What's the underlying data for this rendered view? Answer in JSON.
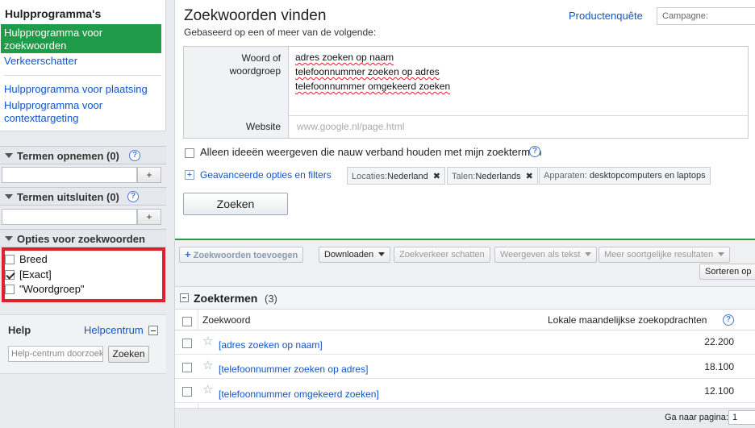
{
  "sidebar": {
    "tools_title": "Hulpprogramma's",
    "tools": [
      "Hulpprogramma voor zoekwoorden",
      "Verkeerschatter",
      "Hulpprogramma voor plaatsing",
      "Hulpprogramma voor contexttargeting"
    ],
    "include_terms_label": "Termen opnemen (0)",
    "exclude_terms_label": "Termen uitsluiten (0)",
    "add_button": "+",
    "match_options_label": "Opties voor zoekwoorden",
    "match_options": [
      {
        "label": "Breed",
        "checked": false
      },
      {
        "label": "[Exact]",
        "checked": true
      },
      {
        "label": "\"Woordgroep\"",
        "checked": false
      }
    ],
    "help_title": "Help",
    "help_center_link": "Helpcentrum",
    "help_search_placeholder": "Help-centrum doorzoeken",
    "help_search_button": "Zoeken"
  },
  "header": {
    "title": "Zoekwoorden vinden",
    "subtitle": "Gebaseerd op een of meer van de volgende:",
    "product_link": "Productenquête",
    "campaign_placeholder": "Campagne:"
  },
  "form": {
    "keyword_label": "Woord of woordgroep",
    "keywords": [
      "adres zoeken op naam",
      "telefoonnummer zoeken op adres",
      "telefoonnummer omgekeerd zoeken"
    ],
    "website_label": "Website",
    "website_placeholder": "www.google.nl/page.html",
    "close_ideas_label": "Alleen ideeën weergeven die nauw verband houden met mijn zoektermen",
    "advanced_link": "Geavanceerde opties en filters",
    "chips": [
      {
        "key": "Locaties:",
        "value": "Nederland",
        "removable": true
      },
      {
        "key": "Talen:",
        "value": "Nederlands",
        "removable": true
      },
      {
        "key": "Apparaten:",
        "value": "desktopcomputers en laptops",
        "removable": false
      }
    ],
    "search_button": "Zoeken"
  },
  "toolbar": {
    "add_keywords": "Zoekwoorden toevoegen",
    "download": "Downloaden",
    "estimate_traffic": "Zoekverkeer schatten",
    "view_as_text": "Weergeven als tekst",
    "more_like_these": "Meer soortgelijke resultaten",
    "sort": "Sorteren op"
  },
  "results": {
    "section_title": "Zoektermen",
    "section_count": "(3)",
    "col_keyword": "Zoekwoord",
    "col_local_searches": "Lokale maandelijkse zoekopdrachten",
    "rows": [
      {
        "keyword": "[adres zoeken op naam]",
        "local": "22.200"
      },
      {
        "keyword": "[telefoonnummer zoeken op adres]",
        "local": "18.100"
      },
      {
        "keyword": "[telefoonnummer omgekeerd zoeken]",
        "local": "12.100"
      }
    ],
    "goto_page_label": "Ga naar pagina:",
    "goto_page_value": "1"
  },
  "colors": {
    "accent_green": "#1f9c4a",
    "link_blue": "#1155cc",
    "highlight_red": "#e0202a"
  }
}
